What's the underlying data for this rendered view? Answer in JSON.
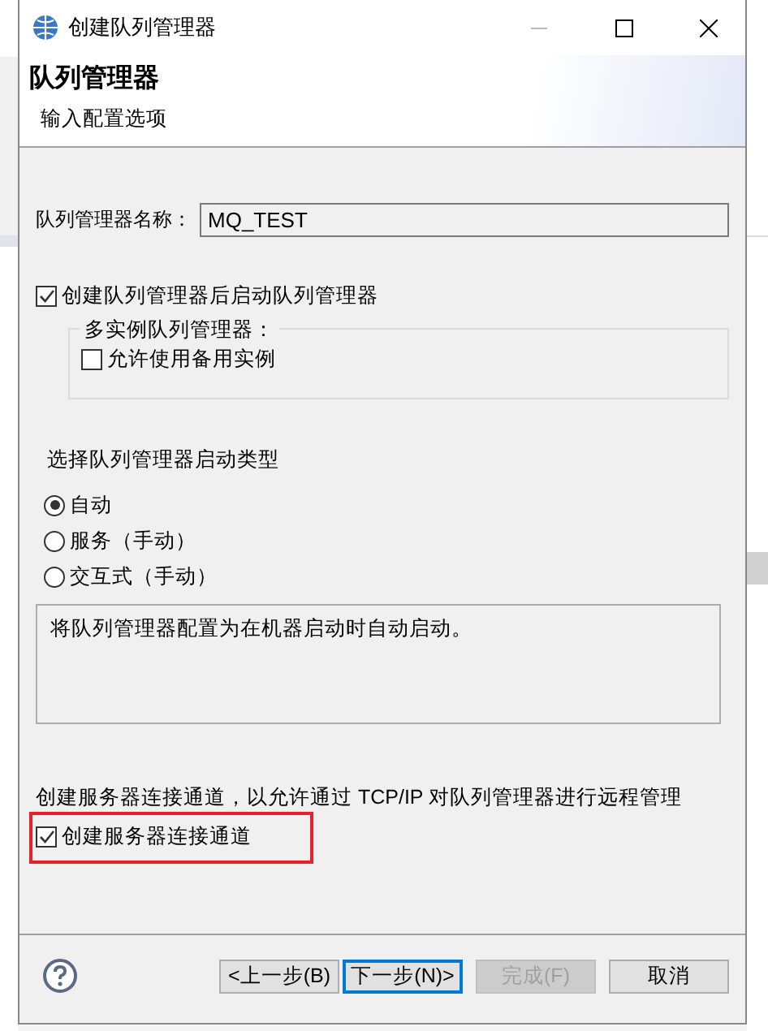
{
  "window": {
    "title": "创建队列管理器"
  },
  "header": {
    "title": "队列管理器",
    "subtitle": "输入配置选项"
  },
  "name_field": {
    "label": "队列管理器名称：",
    "value": "MQ_TEST"
  },
  "start_after_create": {
    "label": "创建队列管理器后启动队列管理器",
    "checked": true
  },
  "multi_instance": {
    "title": "多实例队列管理器：",
    "option": {
      "label": "允许使用备用实例",
      "checked": false
    }
  },
  "startup_type": {
    "label": "选择队列管理器启动类型",
    "options": [
      {
        "label": "自动",
        "selected": true
      },
      {
        "label": "服务（手动）",
        "selected": false
      },
      {
        "label": "交互式（手动）",
        "selected": false
      }
    ],
    "description": "将队列管理器配置为在机器启动时自动启动。"
  },
  "server_channel": {
    "description": "创建服务器连接通道，以允许通过 TCP/IP 对队列管理器进行远程管理",
    "checkbox": {
      "label": "创建服务器连接通道",
      "checked": true,
      "highlighted": true
    }
  },
  "buttons": [
    {
      "label": "<上一步(B)",
      "default": false,
      "disabled": false
    },
    {
      "label": "下一步(N)>",
      "default": true,
      "disabled": false
    },
    {
      "label": "完成(F)",
      "default": false,
      "disabled": true
    },
    {
      "label": "取消",
      "default": false,
      "disabled": false
    }
  ]
}
